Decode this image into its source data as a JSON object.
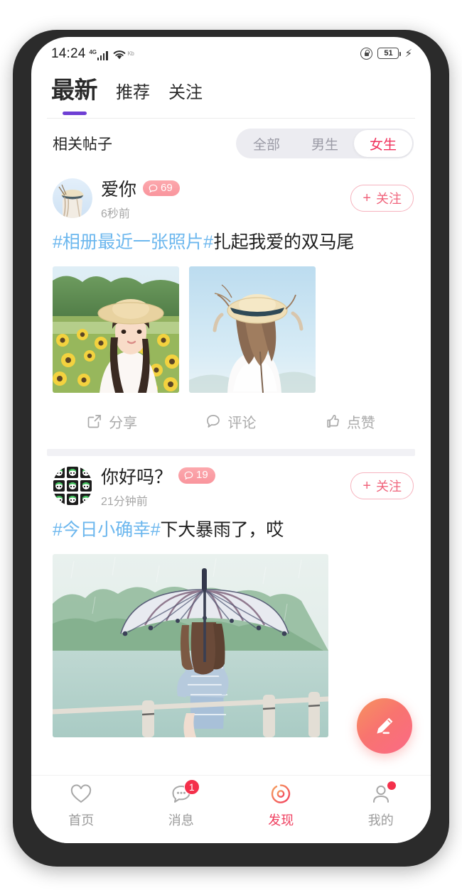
{
  "status_bar": {
    "time": "14:24",
    "network_label": "4G",
    "carrier_text": "Kb",
    "battery_level": "51",
    "icons": [
      "signal-icon",
      "wifi-icon",
      "lock-icon",
      "battery-icon",
      "charging-bolt-icon"
    ]
  },
  "top_tabs": {
    "items": [
      {
        "label": "最新",
        "active": true
      },
      {
        "label": "推荐",
        "active": false
      },
      {
        "label": "关注",
        "active": false
      }
    ],
    "underline_color": "#6e3fd4"
  },
  "filter": {
    "title": "相关帖子",
    "options": [
      {
        "label": "全部",
        "active": false
      },
      {
        "label": "男生",
        "active": false
      },
      {
        "label": "女生",
        "active": true
      }
    ],
    "active_color": "#f0305a"
  },
  "feed": {
    "posts": [
      {
        "username": "爱你",
        "comment_count": "69",
        "time": "6秒前",
        "follow_label": "关注",
        "follow_plus": "+",
        "hashtag": "#相册最近一张照片#",
        "body": "扎起我爱的双马尾",
        "photos": [
          "sunflower-field-girl-photo",
          "straw-hat-sky-photo"
        ],
        "actions": [
          {
            "label": "分享",
            "icon": "share-icon"
          },
          {
            "label": "评论",
            "icon": "comment-bubble-icon"
          },
          {
            "label": "点赞",
            "icon": "thumbs-up-icon"
          }
        ]
      },
      {
        "username": "你好吗？",
        "comment_count": "19",
        "time": "21分钟前",
        "follow_label": "关注",
        "follow_plus": "+",
        "hashtag": "#今日小确幸#",
        "body": "下大暴雨了，哎",
        "photos": [
          "girl-with-umbrella-by-lake-photo"
        ]
      }
    ]
  },
  "fab": {
    "icon": "edit-pencil-icon"
  },
  "bottom_nav": {
    "items": [
      {
        "label": "首页",
        "icon": "heart-icon",
        "active": false,
        "badge": ""
      },
      {
        "label": "消息",
        "icon": "message-bubble-icon",
        "active": false,
        "badge": "1"
      },
      {
        "label": "发现",
        "icon": "discover-ring-icon",
        "active": true,
        "badge": ""
      },
      {
        "label": "我的",
        "icon": "person-icon",
        "active": false,
        "badge": "dot"
      }
    ],
    "active_color": "#ef3f5f"
  }
}
